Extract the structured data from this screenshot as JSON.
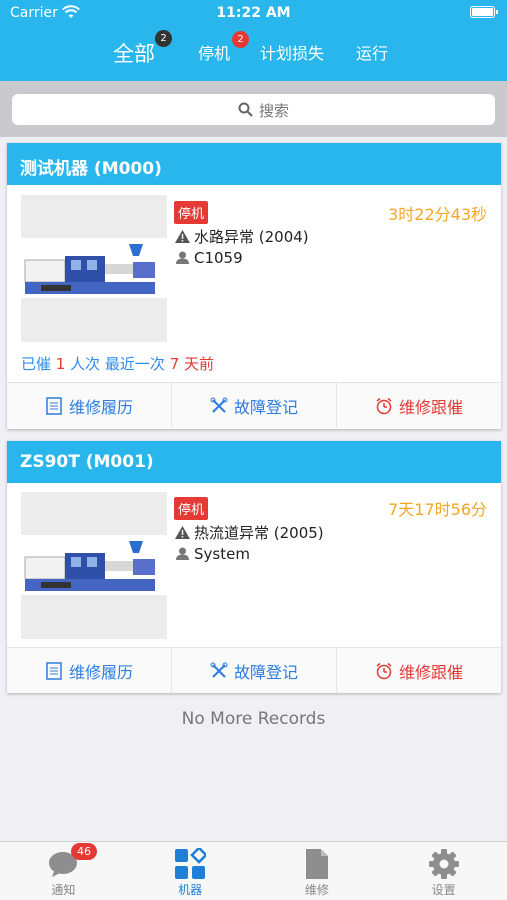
{
  "status_bar": {
    "carrier": "Carrier",
    "time": "11:22 AM"
  },
  "tabs": [
    {
      "label": "全部",
      "badge": "2",
      "active": true
    },
    {
      "label": "停机",
      "badge": "2",
      "active": false
    },
    {
      "label": "计划损失",
      "badge": "",
      "active": false
    },
    {
      "label": "运行",
      "badge": "",
      "active": false
    }
  ],
  "search": {
    "placeholder": "搜索"
  },
  "machines": [
    {
      "title": "测试机器 (M000)",
      "status": "停机",
      "duration": "3时22分43秒",
      "alarm": "水路异常 (2004)",
      "user": "C1059",
      "urge": {
        "prefix": "已催",
        "count": "1",
        "mid": "人次 最近一次",
        "days": "7",
        "suffix": "天前"
      },
      "actions": [
        "维修履历",
        "故障登记",
        "维修跟催"
      ]
    },
    {
      "title": "ZS90T (M001)",
      "status": "停机",
      "duration": "7天17时56分",
      "alarm": "热流道异常 (2005)",
      "user": "System",
      "actions": [
        "维修履历",
        "故障登记",
        "维修跟催"
      ]
    }
  ],
  "footer_text": "No More Records",
  "tabbar": [
    {
      "label": "通知",
      "icon": "chat-bubble-icon",
      "badge": "46"
    },
    {
      "label": "机器",
      "icon": "grid-icon",
      "active": true
    },
    {
      "label": "维修",
      "icon": "document-icon"
    },
    {
      "label": "设置",
      "icon": "gear-icon"
    }
  ],
  "colors": {
    "primary": "#29b6ec",
    "alert": "#e53935",
    "warning": "#f5a623",
    "link": "#2d8cf0"
  }
}
